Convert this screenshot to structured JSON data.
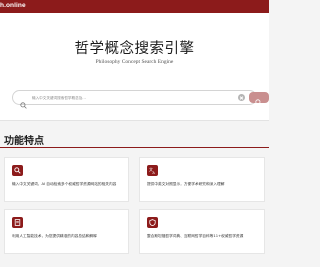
{
  "header": {
    "brand": "h.online"
  },
  "hero": {
    "title": "哲学概念搜索引擎",
    "subtitle": "Philosophy Concept Search Engine"
  },
  "search": {
    "placeholder": "输入中文关键词搜索哲学概念及...",
    "icon": "search-icon",
    "clear_icon": "clear-icon",
    "button_icon": "search-icon",
    "button_color": "#c98f8f"
  },
  "features": {
    "title": "功能特点",
    "accent_color": "#8c1b1b",
    "cards": [
      {
        "icon": "search-icon",
        "text": "输入中文关键词，AI 自动检索多个权威哲学资源网站的相关内容"
      },
      {
        "icon": "language-icon",
        "text": "提供中英文对照显示，方便学术研究和深入理解"
      },
      {
        "icon": "document-icon",
        "text": "利用人工智能技术，为您提供精准的内容总结和解释"
      },
      {
        "icon": "shield-icon",
        "text": "整合斯坦福哲学词典、互联网哲学百科等11+权威哲学资源"
      }
    ]
  }
}
